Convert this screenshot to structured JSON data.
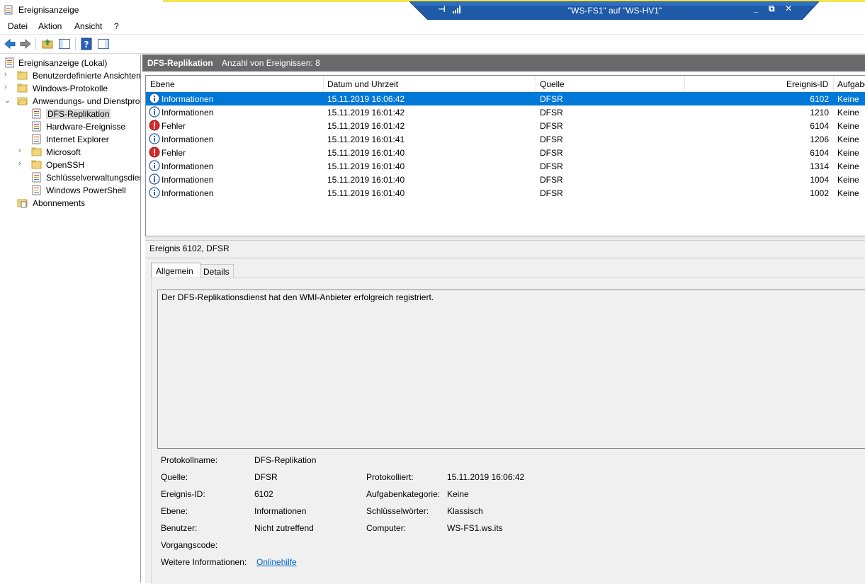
{
  "window": {
    "title": "Ereignisanzeige"
  },
  "remote_bar": {
    "title": "\"WS-FS1\" auf \"WS-HV1\""
  },
  "menu": [
    "Datei",
    "Aktion",
    "Ansicht",
    "?"
  ],
  "tree": {
    "root": "Ereignisanzeige (Lokal)",
    "items": {
      "custom_views": "Benutzerdefinierte Ansichten",
      "windows_logs": "Windows-Protokolle",
      "app_services": "Anwendungs- und Dienstprotokolle",
      "dfs": "DFS-Replikation",
      "hardware": "Hardware-Ereignisse",
      "ie": "Internet Explorer",
      "microsoft": "Microsoft",
      "openssh": "OpenSSH",
      "key_mgmt": "Schlüsselverwaltungsdienst",
      "powershell": "Windows PowerShell",
      "subscriptions": "Abonnements"
    }
  },
  "header": {
    "log_name": "DFS-Replikation",
    "event_count": "Anzahl von Ereignissen: 8"
  },
  "grid": {
    "columns": {
      "level": "Ebene",
      "date": "Datum und Uhrzeit",
      "source": "Quelle",
      "id": "Ereignis-ID",
      "task": "Aufgabenkategorie"
    },
    "rows": [
      {
        "type": "info",
        "level": "Informationen",
        "date": "15.11.2019 16:06:42",
        "source": "DFSR",
        "id": "6102",
        "task": "Keine"
      },
      {
        "type": "info",
        "level": "Informationen",
        "date": "15.11.2019 16:01:42",
        "source": "DFSR",
        "id": "1210",
        "task": "Keine"
      },
      {
        "type": "error",
        "level": "Fehler",
        "date": "15.11.2019 16:01:42",
        "source": "DFSR",
        "id": "6104",
        "task": "Keine"
      },
      {
        "type": "info",
        "level": "Informationen",
        "date": "15.11.2019 16:01:41",
        "source": "DFSR",
        "id": "1206",
        "task": "Keine"
      },
      {
        "type": "error",
        "level": "Fehler",
        "date": "15.11.2019 16:01:40",
        "source": "DFSR",
        "id": "6104",
        "task": "Keine"
      },
      {
        "type": "info",
        "level": "Informationen",
        "date": "15.11.2019 16:01:40",
        "source": "DFSR",
        "id": "1314",
        "task": "Keine"
      },
      {
        "type": "info",
        "level": "Informationen",
        "date": "15.11.2019 16:01:40",
        "source": "DFSR",
        "id": "1004",
        "task": "Keine"
      },
      {
        "type": "info",
        "level": "Informationen",
        "date": "15.11.2019 16:01:40",
        "source": "DFSR",
        "id": "1002",
        "task": "Keine"
      }
    ]
  },
  "detail": {
    "title": "Ereignis 6102, DFSR",
    "tabs": {
      "general": "Allgemein",
      "details": "Details"
    },
    "message": "Der DFS-Replikationsdienst hat den WMI-Anbieter erfolgreich registriert.",
    "labels": {
      "log_name": "Protokollname:",
      "source": "Quelle:",
      "event_id": "Ereignis-ID:",
      "level": "Ebene:",
      "user": "Benutzer:",
      "opcode": "Vorgangscode:",
      "more_info": "Weitere Informationen:",
      "logged": "Protokolliert:",
      "task_category": "Aufgabenkategorie:",
      "keywords": "Schlüsselwörter:",
      "computer": "Computer:"
    },
    "values": {
      "log_name": "DFS-Replikation",
      "source": "DFSR",
      "event_id": "6102",
      "level": "Informationen",
      "user": "Nicht zutreffend",
      "more_info": "Onlinehilfe",
      "logged": "15.11.2019 16:06:42",
      "task_category": "Keine",
      "keywords": "Klassisch",
      "computer": "WS-FS1.ws.its"
    }
  },
  "colors": {
    "selection": "#0078d7",
    "header_bg": "#6a6a6a",
    "remote_bar": "#1e5aa8",
    "link": "#0066cc"
  }
}
